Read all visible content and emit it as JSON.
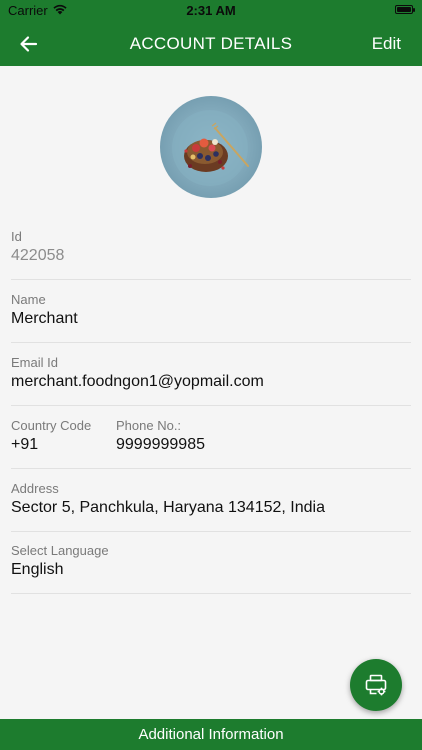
{
  "status_bar": {
    "carrier": "Carrier",
    "time": "2:31 AM",
    "wifi_icon": "wifi-icon",
    "battery_icon": "battery-icon"
  },
  "nav": {
    "title": "ACCOUNT DETAILS",
    "edit_label": "Edit",
    "back_icon": "arrow-left-icon"
  },
  "avatar": {
    "description_icon": "food-plate-photo"
  },
  "fields": {
    "id": {
      "label": "Id",
      "value": "422058"
    },
    "name": {
      "label": "Name",
      "value": "Merchant"
    },
    "email": {
      "label": "Email Id",
      "value": "merchant.foodngon1@yopmail.com"
    },
    "country_code": {
      "label": "Country Code",
      "value": "+91"
    },
    "phone": {
      "label": "Phone No.:",
      "value": "9999999985"
    },
    "address": {
      "label": "Address",
      "value": "Sector 5, Panchkula, Haryana 134152, India"
    },
    "language": {
      "label": "Select Language",
      "value": "English"
    }
  },
  "fab": {
    "icon": "printer-settings-icon"
  },
  "bottom_bar": {
    "label": "Additional Information"
  },
  "colors": {
    "brand_green": "#1d7c2e",
    "background": "#f5f5f5",
    "label_gray": "#7a7a7a"
  }
}
